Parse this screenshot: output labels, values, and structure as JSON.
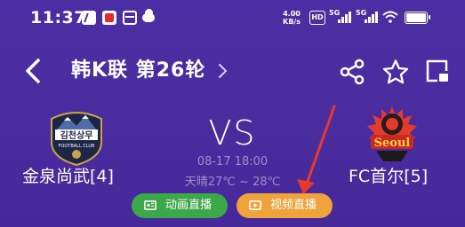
{
  "status_bar": {
    "time": "11:37",
    "net_speed_value": "4.00",
    "net_speed_unit": "KB/s",
    "hd_label": "HD",
    "sig1_label": "5G",
    "sig2_label": "5G"
  },
  "nav": {
    "title": "韩K联  第26轮"
  },
  "match": {
    "home_team": "金泉尚武[4]",
    "away_team": "FC首尔[5]",
    "home_logo_text": "김천상무",
    "home_logo_sub": "FOOTBALL CLUB",
    "away_logo_text": "Seoul",
    "vs": "VS",
    "time": "08-17 18:00",
    "weather": "天晴27℃ ~ 28℃"
  },
  "buttons": {
    "animation_live": "动画直播",
    "video_live": "视频直播"
  },
  "colors": {
    "background": "#4a2c9e",
    "animation_button": "#3da84a",
    "video_button": "#f0a33a",
    "annotation_arrow": "#e8392f",
    "muted_text": "#9a8fc8"
  },
  "icons": {
    "back": "chevron-left-icon",
    "title_more": "chevron-right-icon",
    "share": "share-icon",
    "favorite": "star-icon",
    "float_window": "picture-in-picture-icon",
    "animation": "animation-icon",
    "video": "video-play-icon"
  }
}
